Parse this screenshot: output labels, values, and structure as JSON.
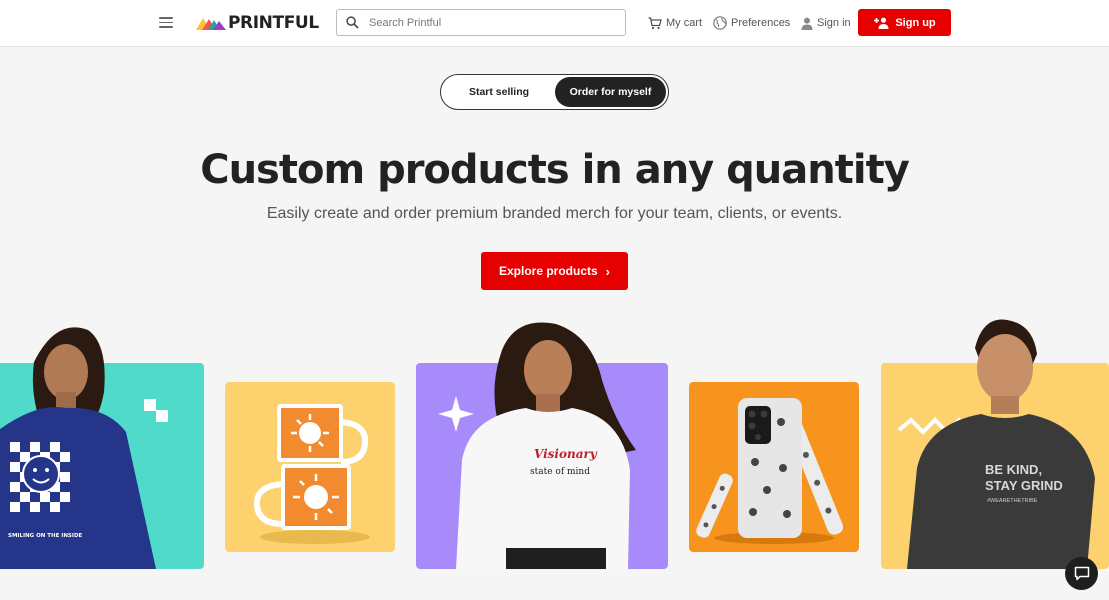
{
  "header": {
    "menu_icon": "hamburger-menu-icon",
    "logo_text": "PRINTFUL",
    "search_placeholder": "Search Printful",
    "cart_label": "My cart",
    "preferences_label": "Preferences",
    "signin_label": "Sign in",
    "signup_label": "Sign up"
  },
  "toggle": {
    "options": [
      "Start selling",
      "Order for myself"
    ],
    "selected": "Order for myself"
  },
  "hero": {
    "title": "Custom products in any quantity",
    "subtitle": "Easily create and order premium branded merch for your team, clients, or events.",
    "cta_label": "Explore products"
  },
  "products": {
    "sweatshirt_print": "SMILING ON THE INSIDE",
    "crewneck_print_1": "Visionary",
    "crewneck_print_2": "state of mind",
    "tee_print_1": "BE KIND,",
    "tee_print_2": "STAY GRIND",
    "tee_print_3": "#WEARETHETRIBE"
  },
  "colors": {
    "brand_red": "#e60000",
    "dark": "#222222",
    "teal": "#4fdac9",
    "yellow": "#fdd26e",
    "purple": "#a78bfa",
    "orange": "#f7941d"
  },
  "chat_icon": "chat-bubble-icon"
}
